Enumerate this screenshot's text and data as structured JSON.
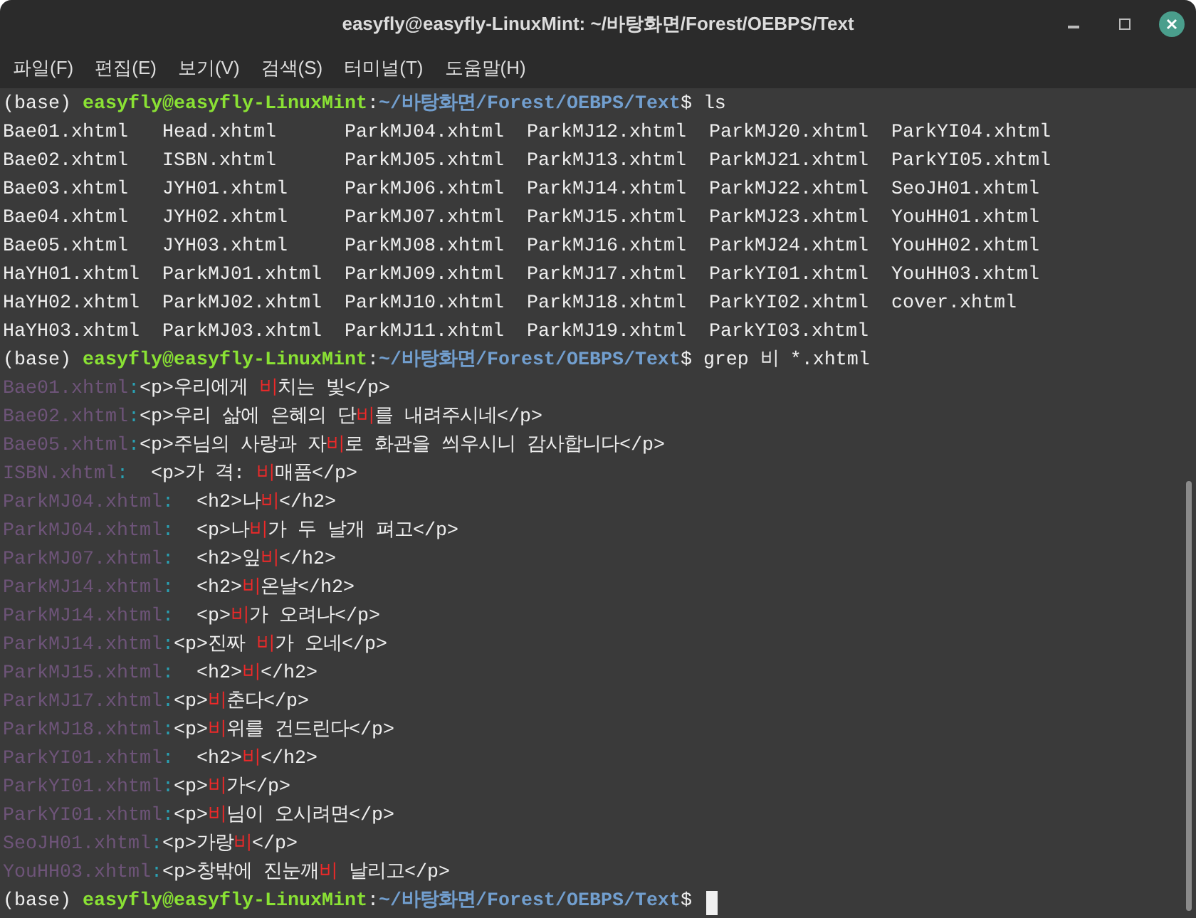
{
  "window": {
    "title": "easyfly@easyfly-LinuxMint: ~/바탕화면/Forest/OEBPS/Text"
  },
  "menu": [
    "파일(F)",
    "편집(E)",
    "보기(V)",
    "검색(S)",
    "터미널(T)",
    "도움말(H)"
  ],
  "terminal": {
    "lines": [
      {
        "kind": "prompt",
        "env": "(base)",
        "user": "easyfly@easyfly-LinuxMint",
        "sep": ":",
        "path": "~/바탕화면/Forest/OEBPS/Text",
        "symbol": "$",
        "command": "ls",
        "cursor": false
      },
      {
        "kind": "ls",
        "cells": [
          "Bae01.xhtml",
          "Head.xhtml",
          "ParkMJ04.xhtml",
          "ParkMJ12.xhtml",
          "ParkMJ20.xhtml",
          "ParkYI04.xhtml"
        ]
      },
      {
        "kind": "ls",
        "cells": [
          "Bae02.xhtml",
          "ISBN.xhtml",
          "ParkMJ05.xhtml",
          "ParkMJ13.xhtml",
          "ParkMJ21.xhtml",
          "ParkYI05.xhtml"
        ]
      },
      {
        "kind": "ls",
        "cells": [
          "Bae03.xhtml",
          "JYH01.xhtml",
          "ParkMJ06.xhtml",
          "ParkMJ14.xhtml",
          "ParkMJ22.xhtml",
          "SeoJH01.xhtml"
        ]
      },
      {
        "kind": "ls",
        "cells": [
          "Bae04.xhtml",
          "JYH02.xhtml",
          "ParkMJ07.xhtml",
          "ParkMJ15.xhtml",
          "ParkMJ23.xhtml",
          "YouHH01.xhtml"
        ]
      },
      {
        "kind": "ls",
        "cells": [
          "Bae05.xhtml",
          "JYH03.xhtml",
          "ParkMJ08.xhtml",
          "ParkMJ16.xhtml",
          "ParkMJ24.xhtml",
          "YouHH02.xhtml"
        ]
      },
      {
        "kind": "ls",
        "cells": [
          "HaYH01.xhtml",
          "ParkMJ01.xhtml",
          "ParkMJ09.xhtml",
          "ParkMJ17.xhtml",
          "ParkYI01.xhtml",
          "YouHH03.xhtml"
        ]
      },
      {
        "kind": "ls",
        "cells": [
          "HaYH02.xhtml",
          "ParkMJ02.xhtml",
          "ParkMJ10.xhtml",
          "ParkMJ18.xhtml",
          "ParkYI02.xhtml",
          "cover.xhtml"
        ]
      },
      {
        "kind": "ls",
        "cells": [
          "HaYH03.xhtml",
          "ParkMJ03.xhtml",
          "ParkMJ11.xhtml",
          "ParkMJ19.xhtml",
          "ParkYI03.xhtml"
        ]
      },
      {
        "kind": "prompt",
        "env": "(base)",
        "user": "easyfly@easyfly-LinuxMint",
        "sep": ":",
        "path": "~/바탕화면/Forest/OEBPS/Text",
        "symbol": "$",
        "command": "grep 비 *.xhtml",
        "cursor": false
      },
      {
        "kind": "grep",
        "file": "Bae01.xhtml",
        "sep": ":",
        "segments": [
          {
            "text": "<p>우리에게 ",
            "match": false
          },
          {
            "text": "비",
            "match": true
          },
          {
            "text": "치는 빛</p>",
            "match": false
          }
        ]
      },
      {
        "kind": "grep",
        "file": "Bae02.xhtml",
        "sep": ":",
        "segments": [
          {
            "text": "<p>우리 삶에 은혜의 단",
            "match": false
          },
          {
            "text": "비",
            "match": true
          },
          {
            "text": "를 내려주시네</p>",
            "match": false
          }
        ]
      },
      {
        "kind": "grep",
        "file": "Bae05.xhtml",
        "sep": ":",
        "segments": [
          {
            "text": "<p>주님의 사랑과 자",
            "match": false
          },
          {
            "text": "비",
            "match": true
          },
          {
            "text": "로 화관을 씌우시니 감사합니다</p>",
            "match": false
          }
        ]
      },
      {
        "kind": "grep",
        "file": "ISBN.xhtml",
        "sep": ":",
        "segments": [
          {
            "text": "  <p>가 격: ",
            "match": false
          },
          {
            "text": "비",
            "match": true
          },
          {
            "text": "매품</p>",
            "match": false
          }
        ]
      },
      {
        "kind": "grep",
        "file": "ParkMJ04.xhtml",
        "sep": ":",
        "segments": [
          {
            "text": "  <h2>나",
            "match": false
          },
          {
            "text": "비",
            "match": true
          },
          {
            "text": "</h2>",
            "match": false
          }
        ]
      },
      {
        "kind": "grep",
        "file": "ParkMJ04.xhtml",
        "sep": ":",
        "segments": [
          {
            "text": "  <p>나",
            "match": false
          },
          {
            "text": "비",
            "match": true
          },
          {
            "text": "가 두 날개 펴고</p>",
            "match": false
          }
        ]
      },
      {
        "kind": "grep",
        "file": "ParkMJ07.xhtml",
        "sep": ":",
        "segments": [
          {
            "text": "  <h2>잎",
            "match": false
          },
          {
            "text": "비",
            "match": true
          },
          {
            "text": "</h2>",
            "match": false
          }
        ]
      },
      {
        "kind": "grep",
        "file": "ParkMJ14.xhtml",
        "sep": ":",
        "segments": [
          {
            "text": "  <h2>",
            "match": false
          },
          {
            "text": "비",
            "match": true
          },
          {
            "text": "온날</h2>",
            "match": false
          }
        ]
      },
      {
        "kind": "grep",
        "file": "ParkMJ14.xhtml",
        "sep": ":",
        "segments": [
          {
            "text": "  <p>",
            "match": false
          },
          {
            "text": "비",
            "match": true
          },
          {
            "text": "가 오려나</p>",
            "match": false
          }
        ]
      },
      {
        "kind": "grep",
        "file": "ParkMJ14.xhtml",
        "sep": ":",
        "segments": [
          {
            "text": "<p>진짜 ",
            "match": false
          },
          {
            "text": "비",
            "match": true
          },
          {
            "text": "가 오네</p>",
            "match": false
          }
        ]
      },
      {
        "kind": "grep",
        "file": "ParkMJ15.xhtml",
        "sep": ":",
        "segments": [
          {
            "text": "  <h2>",
            "match": false
          },
          {
            "text": "비",
            "match": true
          },
          {
            "text": "</h2>",
            "match": false
          }
        ]
      },
      {
        "kind": "grep",
        "file": "ParkMJ17.xhtml",
        "sep": ":",
        "segments": [
          {
            "text": "<p>",
            "match": false
          },
          {
            "text": "비",
            "match": true
          },
          {
            "text": "춘다</p>",
            "match": false
          }
        ]
      },
      {
        "kind": "grep",
        "file": "ParkMJ18.xhtml",
        "sep": ":",
        "segments": [
          {
            "text": "<p>",
            "match": false
          },
          {
            "text": "비",
            "match": true
          },
          {
            "text": "위를 건드린다</p>",
            "match": false
          }
        ]
      },
      {
        "kind": "grep",
        "file": "ParkYI01.xhtml",
        "sep": ":",
        "segments": [
          {
            "text": "  <h2>",
            "match": false
          },
          {
            "text": "비",
            "match": true
          },
          {
            "text": "</h2>",
            "match": false
          }
        ]
      },
      {
        "kind": "grep",
        "file": "ParkYI01.xhtml",
        "sep": ":",
        "segments": [
          {
            "text": "<p>",
            "match": false
          },
          {
            "text": "비",
            "match": true
          },
          {
            "text": "가</p>",
            "match": false
          }
        ]
      },
      {
        "kind": "grep",
        "file": "ParkYI01.xhtml",
        "sep": ":",
        "segments": [
          {
            "text": "<p>",
            "match": false
          },
          {
            "text": "비",
            "match": true
          },
          {
            "text": "님이 오시려면</p>",
            "match": false
          }
        ]
      },
      {
        "kind": "grep",
        "file": "SeoJH01.xhtml",
        "sep": ":",
        "segments": [
          {
            "text": "<p>가랑",
            "match": false
          },
          {
            "text": "비",
            "match": true
          },
          {
            "text": "</p>",
            "match": false
          }
        ]
      },
      {
        "kind": "grep",
        "file": "YouHH03.xhtml",
        "sep": ":",
        "segments": [
          {
            "text": "<p>창밖에 진눈깨",
            "match": false
          },
          {
            "text": "비",
            "match": true
          },
          {
            "text": " 날리고</p>",
            "match": false
          }
        ]
      },
      {
        "kind": "prompt",
        "env": "(base)",
        "user": "easyfly@easyfly-LinuxMint",
        "sep": ":",
        "path": "~/바탕화면/Forest/OEBPS/Text",
        "symbol": "$",
        "cursor": true
      }
    ]
  }
}
